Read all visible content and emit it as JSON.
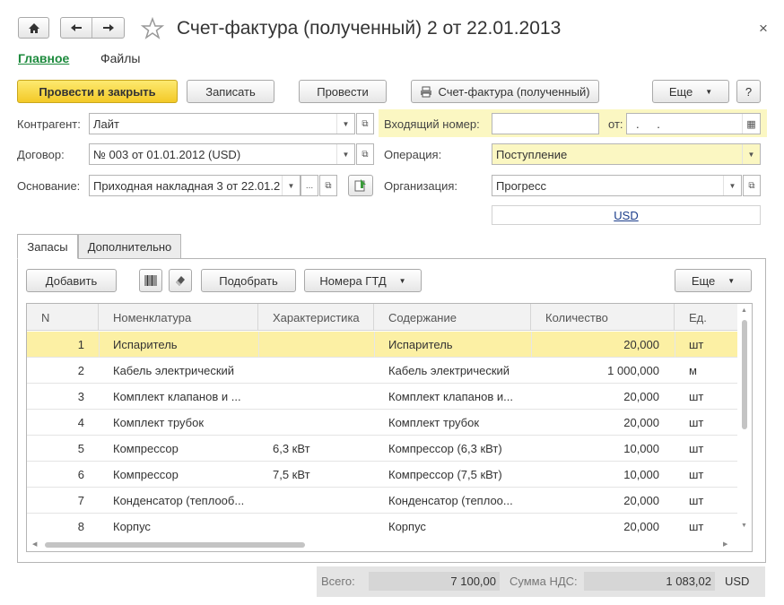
{
  "window": {
    "title": "Счет-фактура (полученный) 2 от 22.01.2013",
    "close": "×"
  },
  "nav": {
    "home_icon": "home-icon",
    "back_icon": "arrow-left-icon",
    "forward_icon": "arrow-right-icon",
    "star_icon": "star-icon",
    "links": [
      "Главное",
      "Файлы"
    ]
  },
  "toolbar": {
    "post_close": "Провести и закрыть",
    "save": "Записать",
    "post": "Провести",
    "print": "Счет-фактура (полученный)",
    "more": "Еще",
    "help": "?"
  },
  "form": {
    "contractor_label": "Контрагент:",
    "contractor_value": "Лайт",
    "contract_label": "Договор:",
    "contract_value": "№ 003 от 01.01.2012 (USD)",
    "basis_label": "Основание:",
    "basis_value": "Приходная накладная 3 от 22.01.2",
    "basis_more": "...",
    "incoming_label": "Входящий номер:",
    "incoming_value": "",
    "from_label": "от:",
    "from_value": ".  .",
    "operation_label": "Операция:",
    "operation_value": "Поступление",
    "org_label": "Организация:",
    "org_value": "Прогресс",
    "currency_link": "USD"
  },
  "tabs": [
    "Запасы",
    "Дополнительно"
  ],
  "table_toolbar": {
    "add": "Добавить",
    "select": "Подобрать",
    "gtd": "Номера ГТД",
    "more": "Еще"
  },
  "table": {
    "columns": [
      "N",
      "Номенклатура",
      "Характеристика",
      "Содержание",
      "Количество",
      "Ед."
    ],
    "rows": [
      {
        "n": "1",
        "item": "Испаритель",
        "char": "",
        "content": "Испаритель",
        "qty": "20,000",
        "unit": "шт"
      },
      {
        "n": "2",
        "item": "Кабель электрический",
        "char": "",
        "content": "Кабель электрический",
        "qty": "1 000,000",
        "unit": "м"
      },
      {
        "n": "3",
        "item": "Комплект клапанов и ...",
        "char": "",
        "content": "Комплект клапанов и...",
        "qty": "20,000",
        "unit": "шт"
      },
      {
        "n": "4",
        "item": "Комплект трубок",
        "char": "",
        "content": "Комплект трубок",
        "qty": "20,000",
        "unit": "шт"
      },
      {
        "n": "5",
        "item": "Компрессор",
        "char": "6,3 кВт",
        "content": "Компрессор (6,3 кВт)",
        "qty": "10,000",
        "unit": "шт"
      },
      {
        "n": "6",
        "item": "Компрессор",
        "char": "7,5 кВт",
        "content": "Компрессор (7,5 кВт)",
        "qty": "10,000",
        "unit": "шт"
      },
      {
        "n": "7",
        "item": "Конденсатор (теплооб...",
        "char": "",
        "content": "Конденсатор (теплоо...",
        "qty": "20,000",
        "unit": "шт"
      },
      {
        "n": "8",
        "item": "Корпус",
        "char": "",
        "content": "Корпус",
        "qty": "20,000",
        "unit": "шт"
      }
    ]
  },
  "totals": {
    "total_label": "Всего:",
    "total_value": "7 100,00",
    "vat_label": "Сумма НДС:",
    "vat_value": "1 083,02",
    "currency": "USD"
  },
  "colors": {
    "accent_link": "#1c8a3c",
    "primary_button": "#f5d23a",
    "highlight_field": "#fbf7c2",
    "selected_row": "#fcf0a4"
  }
}
